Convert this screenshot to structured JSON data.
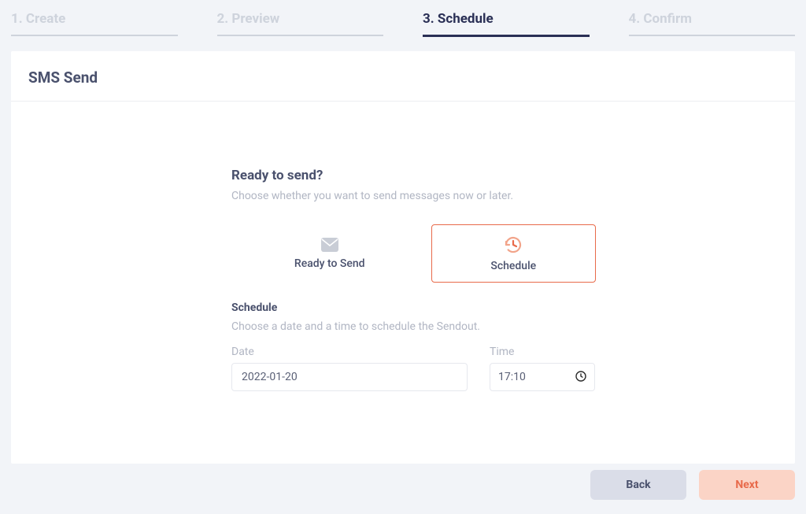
{
  "stepper": {
    "steps": [
      {
        "label": "1. Create",
        "active": false
      },
      {
        "label": "2. Preview",
        "active": false
      },
      {
        "label": "3. Schedule",
        "active": true
      },
      {
        "label": "4. Confirm",
        "active": false
      }
    ]
  },
  "panel": {
    "title": "SMS Send"
  },
  "ready_section": {
    "heading": "Ready to send?",
    "sub": "Choose whether you want to send messages now or later.",
    "options": [
      {
        "label": "Ready to Send",
        "selected": false
      },
      {
        "label": "Schedule",
        "selected": true
      }
    ]
  },
  "schedule_section": {
    "heading": "Schedule",
    "sub": "Choose a date and a time to schedule the Sendout.",
    "date_label": "Date",
    "date_value": "2022-01-20",
    "time_label": "Time",
    "time_value": "17:10"
  },
  "footer": {
    "back": "Back",
    "next": "Next"
  }
}
